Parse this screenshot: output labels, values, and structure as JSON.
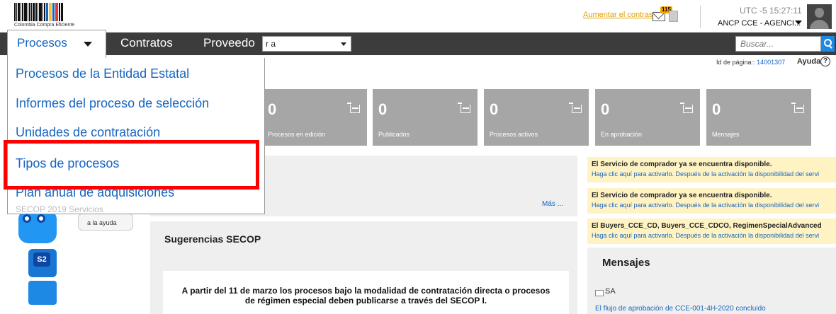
{
  "header": {
    "logo_text": "Colombia Compra Eficiente",
    "contrast_link": "Aumentar el contraste",
    "mail_count": "115",
    "timezone": "UTC -5 15:27:11",
    "user_name": "ANCP CCE - AGENCI..."
  },
  "nav": {
    "tabs": [
      {
        "label": "Procesos"
      },
      {
        "label": "Contratos"
      },
      {
        "label": "Proveedo"
      }
    ],
    "select_value": "r a",
    "search_placeholder": "Buscar..."
  },
  "dropdown": {
    "items": [
      "Procesos de la Entidad Estatal",
      "Informes del proceso de selección",
      "Unidades de contratación",
      "Tipos de procesos",
      "Plan anual de adquisiciones"
    ],
    "clipped_item": "SECOP 2019 Servicios"
  },
  "page": {
    "id_label": "Id de página::",
    "id_value": "14001307",
    "help_label": "Ayuda"
  },
  "tiles": [
    {
      "count": "0",
      "label": "Procesos en edición"
    },
    {
      "count": "0",
      "label": "Publicados"
    },
    {
      "count": "0",
      "label": "Procesos activos"
    },
    {
      "count": "0",
      "label": "En aprobación"
    },
    {
      "count": "0",
      "label": "Mensajes"
    }
  ],
  "panels": {
    "more_link": "Más ...",
    "suggestions_title": "Sugerencias SECOP",
    "suggestion_text": "A partir del 11 de marzo los procesos bajo la modalidad de contratación directa o procesos de régimen especial deben publicarse a través del SECOP I."
  },
  "help_bot": {
    "bubble": "a la ayuda",
    "badge": "S2"
  },
  "notices": [
    {
      "title": "El Servicio de comprador ya se encuentra disponible.",
      "sub": "Haga clic aquí para activarlo. Después de la activación la disponibilidad del servi"
    },
    {
      "title": "El Servicio de comprador ya se encuentra disponible.",
      "sub": "Haga clic aquí para activarlo. Después de la activación la disponibilidad del servi"
    },
    {
      "title": "El Buyers_CCE_CD, Buyers_CCE_CDCO, RegimenSpecialAdvanced",
      "sub": "Haga clic aquí para activarlo. Después de la activación la disponibilidad del servi"
    }
  ],
  "messages": {
    "title": "Mensajes",
    "sender": "SA",
    "link": "El flujo de aprobación de CCE-001-4H-2020 concluido"
  },
  "colors": {
    "nav_bg": "#3c3c3c",
    "link_blue": "#1565c0",
    "tile_gray": "#a6a6a6",
    "notice_yellow": "#fff3c4",
    "highlight_red": "#ff0000"
  }
}
